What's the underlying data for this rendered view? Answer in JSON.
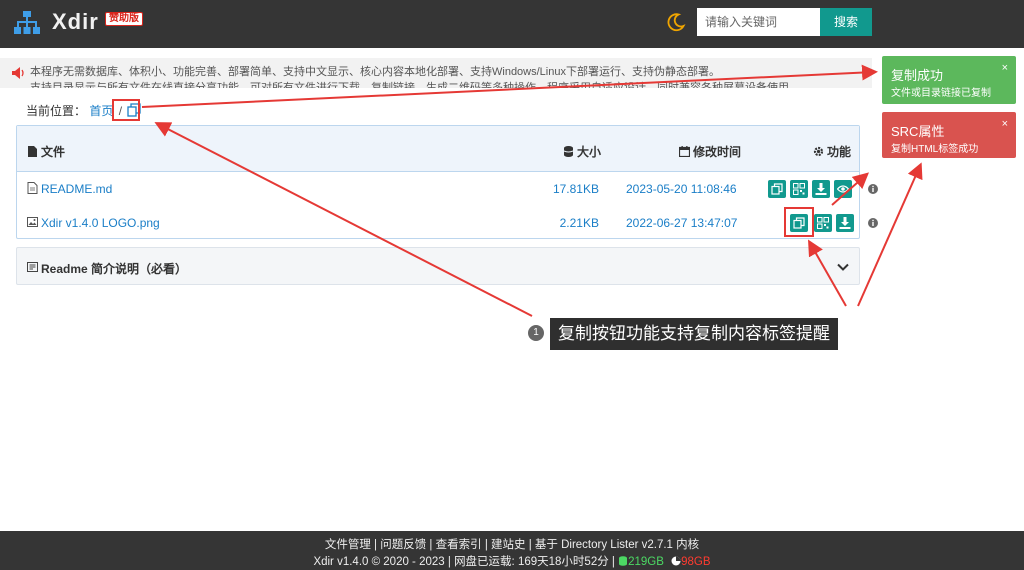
{
  "header": {
    "logo_text": "Xdir",
    "badge": "赞助版",
    "search_placeholder": "请输入关键词",
    "search_button": "搜索"
  },
  "notice": {
    "line1": "本程序无需数据库、体积小、功能完善、部署简单、支持中文显示、核心内容本地化部署、支持Windows/Linux下部署运行、支持伪静态部署。",
    "line2": "支持目录显示与所有文件在线直接分享功能，可对所有文件进行下载、复制链接、生成二维码等多种操作，程序采用自适应设计，同时兼容各种屏幕设备使用。"
  },
  "breadcrumb": {
    "label": "当前位置：",
    "home": "首页",
    "separator": "/"
  },
  "table": {
    "headers": {
      "file": "文件",
      "size": "大小",
      "time": "修改时间",
      "actions": "功能"
    },
    "rows": [
      {
        "name": "README.md",
        "size": "17.81KB",
        "time": "2023-05-20 11:08:46",
        "icon": "file-icon"
      },
      {
        "name": "Xdir v1.4.0 LOGO.png",
        "size": "2.21KB",
        "time": "2022-06-27 13:47:07",
        "icon": "image-icon"
      }
    ]
  },
  "readme": {
    "title": "Readme 简介说明（必看）"
  },
  "toasts": [
    {
      "title": "复制成功",
      "message": "文件或目录链接已复制",
      "close": "×",
      "color": "#5cb85c"
    },
    {
      "title": "SRC属性",
      "message": "复制HTML标签成功",
      "close": "×",
      "color": "#d9534f"
    }
  ],
  "callout": {
    "number": "1",
    "text": "复制按钮功能支持复制内容标签提醒"
  },
  "footer": {
    "links": [
      "文件管理",
      "问题反馈",
      "查看索引",
      "建站史"
    ],
    "based_on": "基于 Directory Lister v2.7.1 内核",
    "copyright": "Xdir v1.4.0 © 2020 - 2023",
    "uptime": "网盘已运载: 169天18小时52分",
    "disk_used": "219GB",
    "disk_free": "98GB"
  },
  "colors": {
    "header_bg": "#353535",
    "accent_teal": "#11998e",
    "link_blue": "#1a7ec7",
    "success_green": "#5cb85c",
    "error_red": "#d9534f",
    "annotation_red": "#e53935"
  }
}
